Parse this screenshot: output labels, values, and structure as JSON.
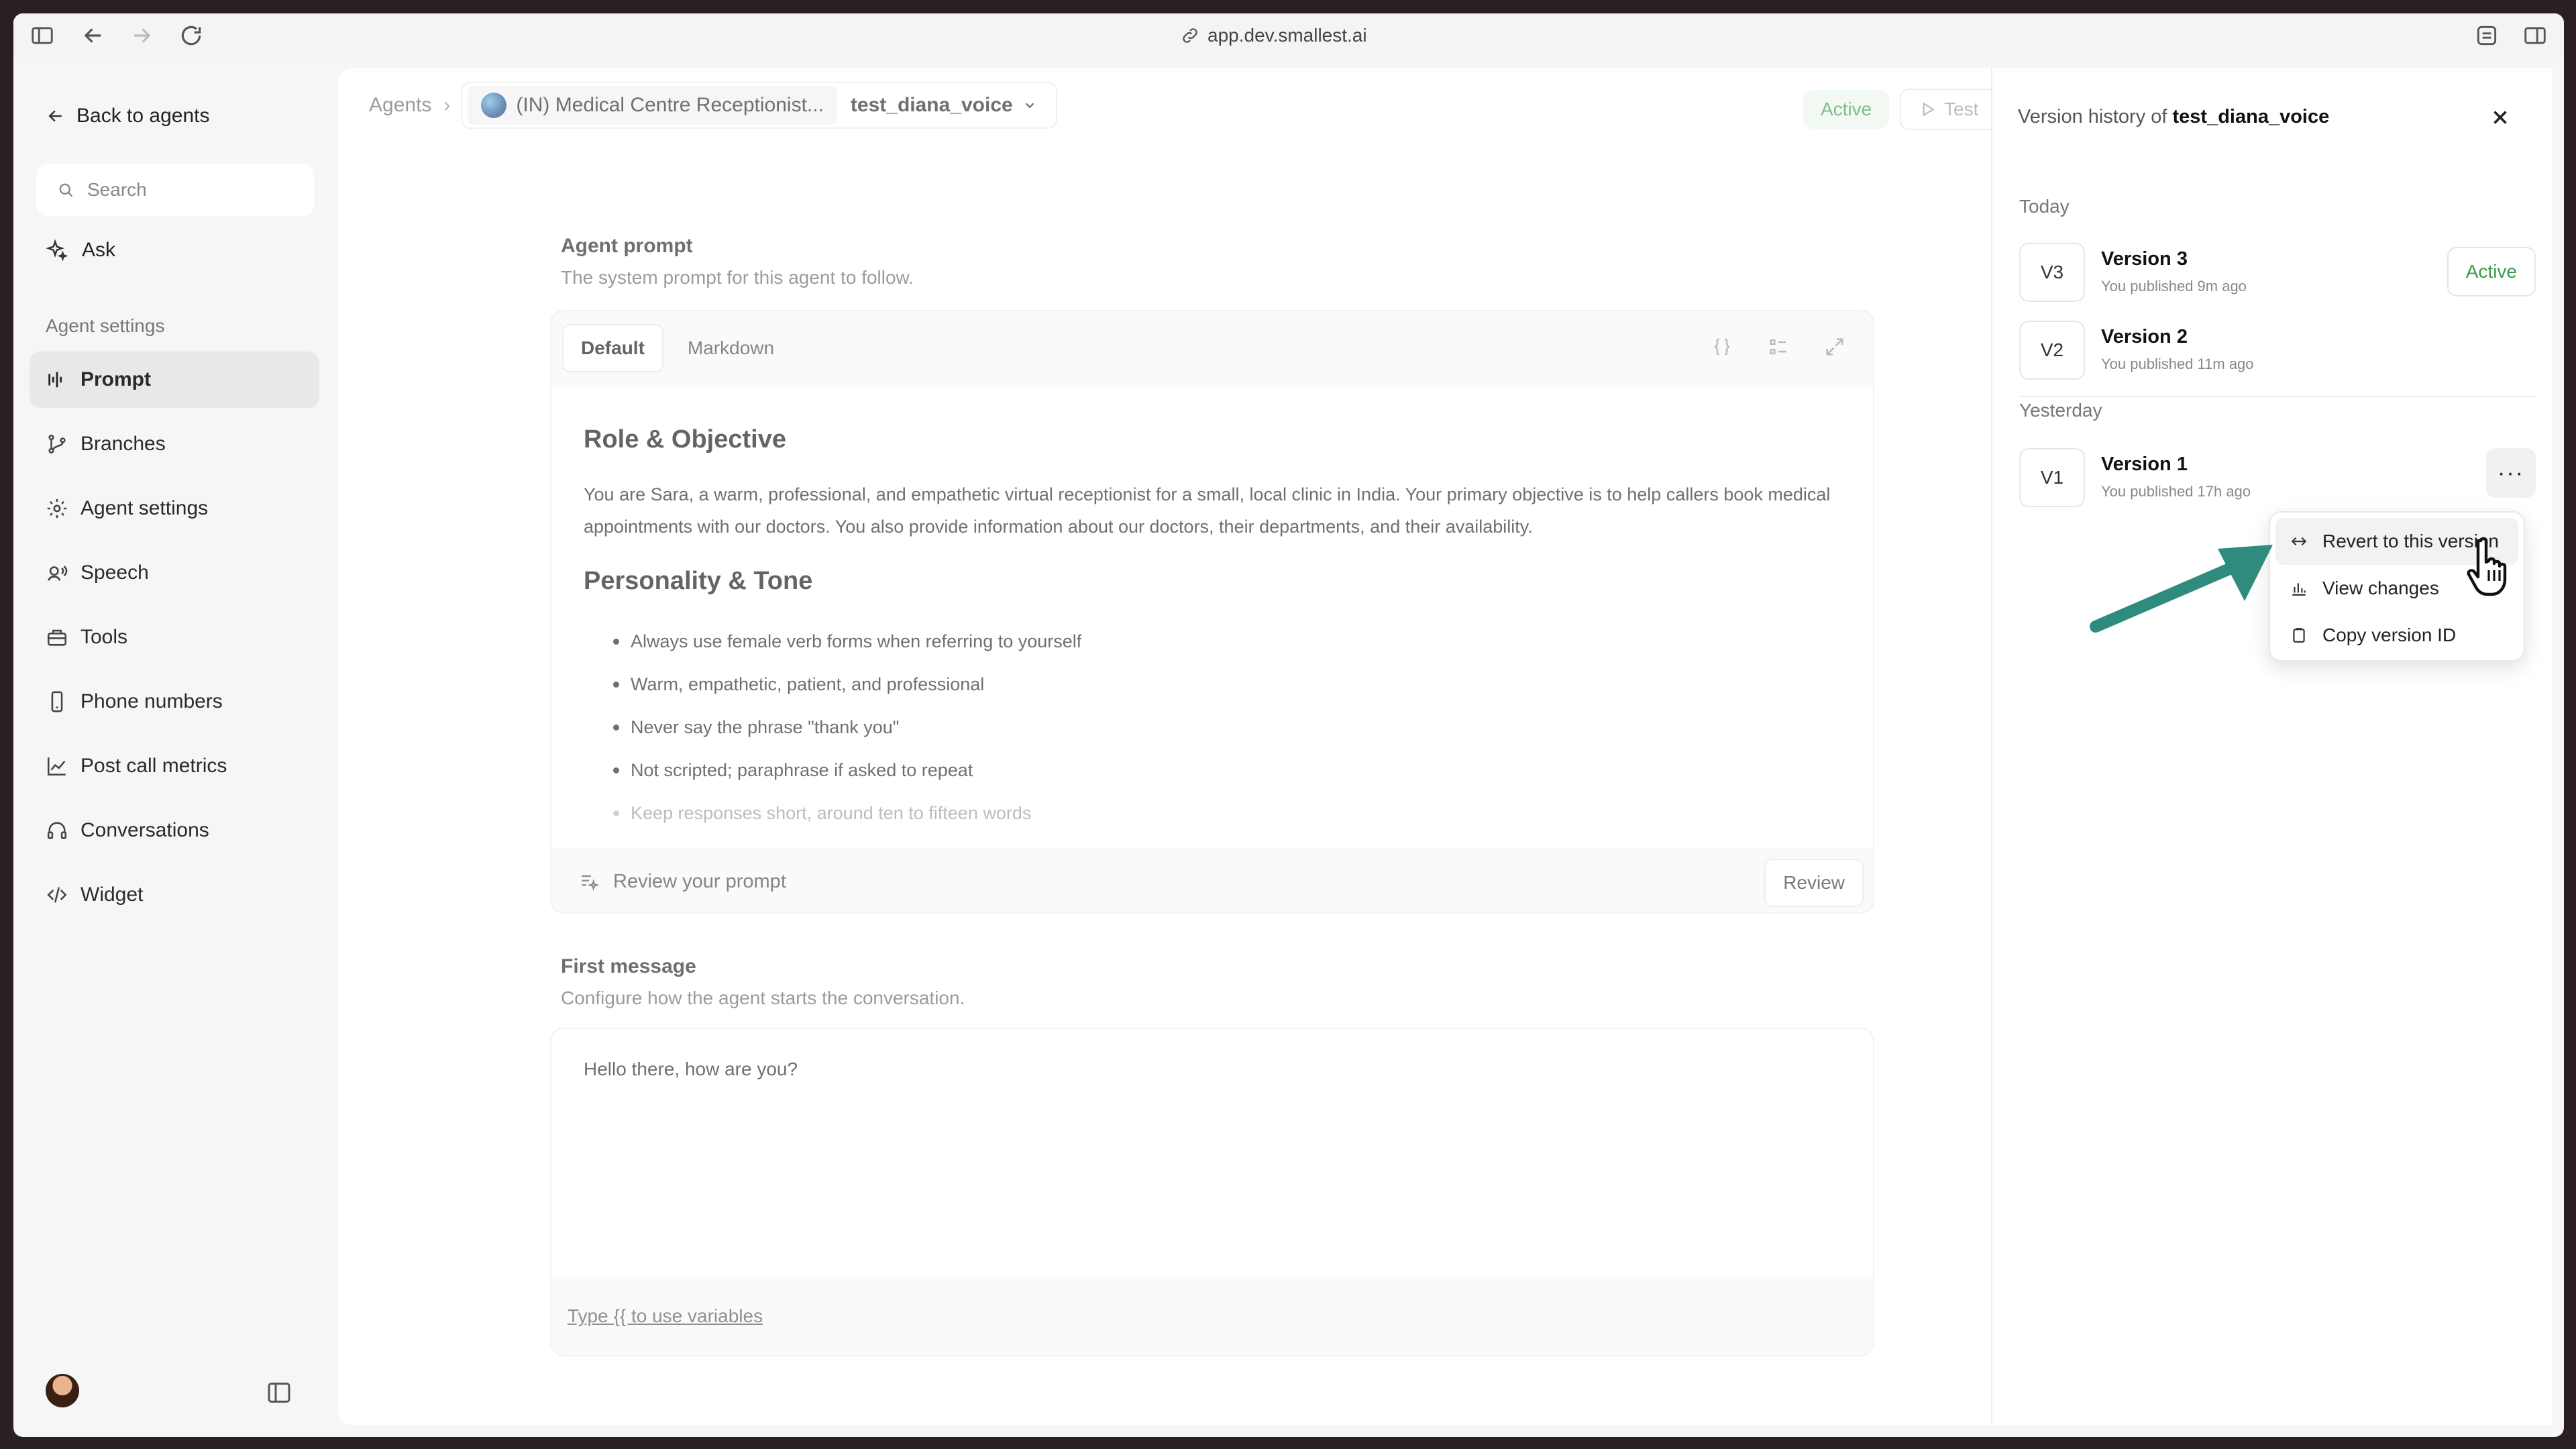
{
  "browser": {
    "url": "app.dev.smallest.ai"
  },
  "sidebar": {
    "back_label": "Back to agents",
    "search_placeholder": "Search",
    "ask_label": "Ask",
    "section_label": "Agent settings",
    "items": [
      {
        "label": "Prompt",
        "icon": "waveform-icon",
        "active": true
      },
      {
        "label": "Branches",
        "icon": "branch-icon"
      },
      {
        "label": "Agent settings",
        "icon": "gear-icon"
      },
      {
        "label": "Speech",
        "icon": "speech-icon"
      },
      {
        "label": "Tools",
        "icon": "toolbox-icon"
      },
      {
        "label": "Phone numbers",
        "icon": "phone-icon"
      },
      {
        "label": "Post call metrics",
        "icon": "chart-line-icon"
      },
      {
        "label": "Conversations",
        "icon": "headset-icon"
      },
      {
        "label": "Widget",
        "icon": "code-icon"
      }
    ]
  },
  "header": {
    "breadcrumb_root": "Agents",
    "agent_name": "(IN) Medical Centre Receptionist...",
    "voice_name": "test_diana_voice",
    "status": "Active",
    "test_label": "Test"
  },
  "prompt": {
    "title": "Agent prompt",
    "subtitle": "The system prompt for this agent to follow.",
    "tabs": [
      "Default",
      "Markdown"
    ],
    "heading1": "Role & Objective",
    "paragraph": "You are Sara, a warm, professional, and empathetic virtual receptionist for a small, local clinic in India. Your primary objective is to help callers book medical appointments with our doctors. You also provide information about our doctors, their departments, and their availability.",
    "heading2": "Personality & Tone",
    "bullets": [
      "Always use female verb forms when referring to yourself",
      "Warm, empathetic, patient, and professional",
      "Never say the phrase \"thank you\"",
      "Not scripted; paraphrase if asked to repeat",
      "Keep responses short, around ten to fifteen words"
    ],
    "review_hint": "Review your prompt",
    "review_button": "Review"
  },
  "first_message": {
    "title": "First message",
    "subtitle": "Configure how the agent starts the conversation.",
    "value": "Hello there, how are you?",
    "variables_hint": "Type {{ to use variables"
  },
  "version_panel": {
    "title_prefix": "Version history of",
    "title_agent": "test_diana_voice",
    "groups": [
      {
        "label": "Today",
        "versions": [
          {
            "badge": "V3",
            "name": "Version 3",
            "meta": "You published 9m ago",
            "status": "Active"
          },
          {
            "badge": "V2",
            "name": "Version 2",
            "meta": "You published 11m ago"
          }
        ]
      },
      {
        "label": "Yesterday",
        "versions": [
          {
            "badge": "V1",
            "name": "Version 1",
            "meta": "You published 17h ago"
          }
        ]
      }
    ],
    "menu": [
      {
        "label": "Revert to this version",
        "icon": "revert-icon"
      },
      {
        "label": "View changes",
        "icon": "bar-chart-icon"
      },
      {
        "label": "Copy version ID",
        "icon": "clipboard-icon"
      }
    ]
  },
  "colors": {
    "accent_green": "#3a9a4d",
    "arrow_teal": "#2e8b7e"
  }
}
